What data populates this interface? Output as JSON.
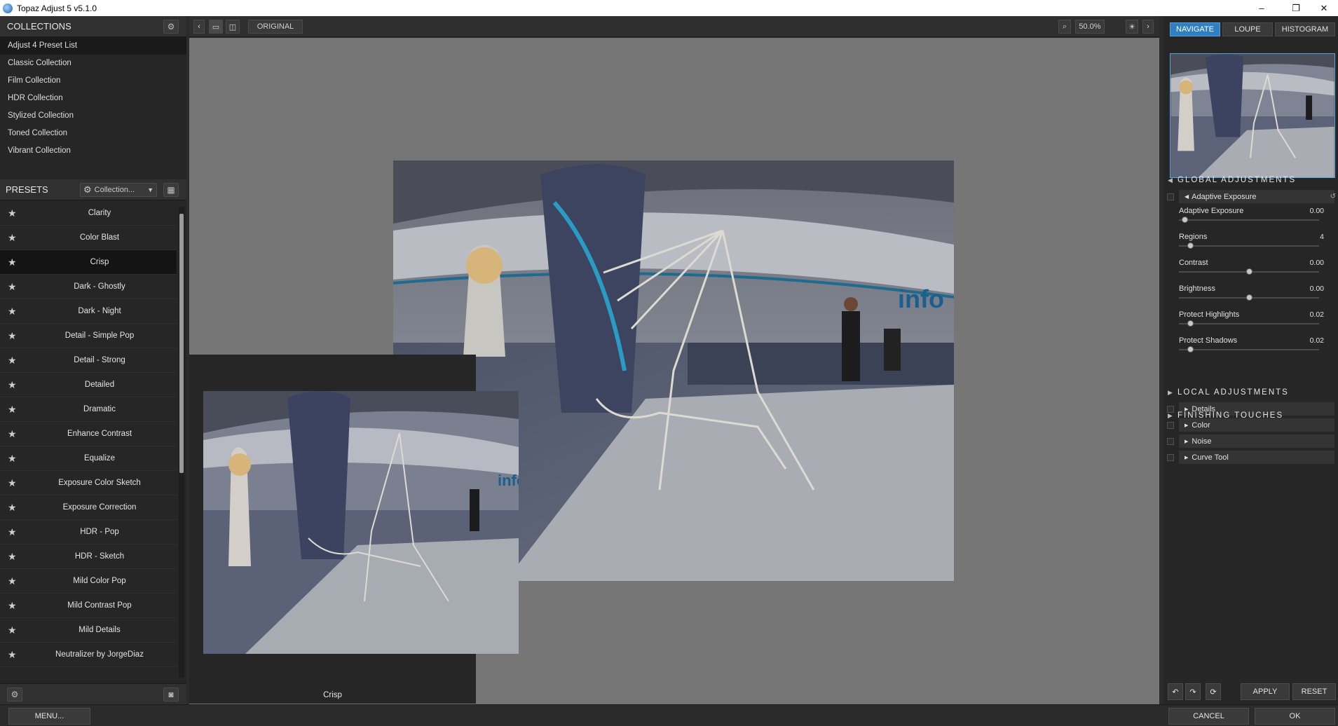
{
  "window": {
    "title": "Topaz Adjust 5 v5.1.0",
    "minimize": "–",
    "restore": "❐",
    "close": "✕"
  },
  "collections": {
    "header": "COLLECTIONS",
    "items": [
      "Adjust 4 Preset List",
      "Classic Collection",
      "Film Collection",
      "HDR Collection",
      "Stylized Collection",
      "Toned Collection",
      "Vibrant Collection"
    ],
    "active_index": 0
  },
  "presets": {
    "header": "PRESETS",
    "filter_label": "Collection...",
    "items": [
      "Clarity",
      "Color Blast",
      "Crisp",
      "Dark - Ghostly",
      "Dark - Night",
      "Detail - Simple Pop",
      "Detail - Strong",
      "Detailed",
      "Dramatic",
      "Enhance Contrast",
      "Equalize",
      "Exposure Color Sketch",
      "Exposure Correction",
      "HDR - Pop",
      "HDR - Sketch",
      "Mild Color Pop",
      "Mild Contrast Pop",
      "Mild Details",
      "Neutralizer by JorgeDiaz"
    ],
    "active_index": 2
  },
  "toolbar": {
    "original_label": "ORIGINAL",
    "zoom": "50.0%"
  },
  "preview": {
    "caption": "Crisp",
    "sign_text": "info"
  },
  "right": {
    "tabs": [
      "NAVIGATE",
      "LOUPE",
      "HISTOGRAM"
    ],
    "active_tab": 0,
    "global_label": "GLOBAL ADJUSTMENTS",
    "adaptive_header": "Adaptive Exposure",
    "sliders": [
      {
        "label": "Adaptive Exposure",
        "value": "0.00",
        "pos": 0.04
      },
      {
        "label": "Regions",
        "value": "4",
        "pos": 0.08
      },
      {
        "label": "Contrast",
        "value": "0.00",
        "pos": 0.5
      },
      {
        "label": "Brightness",
        "value": "0.00",
        "pos": 0.5
      },
      {
        "label": "Protect Highlights",
        "value": "0.02",
        "pos": 0.08
      },
      {
        "label": "Protect Shadows",
        "value": "0.02",
        "pos": 0.08
      }
    ],
    "subsections": [
      "Details",
      "Color",
      "Noise",
      "Curve Tool"
    ],
    "local_label": "LOCAL ADJUSTMENTS",
    "finishing_label": "FINISHING TOUCHES",
    "apply_label": "APPLY",
    "reset_label": "RESET"
  },
  "footer": {
    "menu_label": "MENU...",
    "cancel_label": "CANCEL",
    "ok_label": "OK"
  },
  "colors": {
    "accent": "#2f7fc2",
    "panel": "#262626",
    "canvas": "#767676"
  }
}
